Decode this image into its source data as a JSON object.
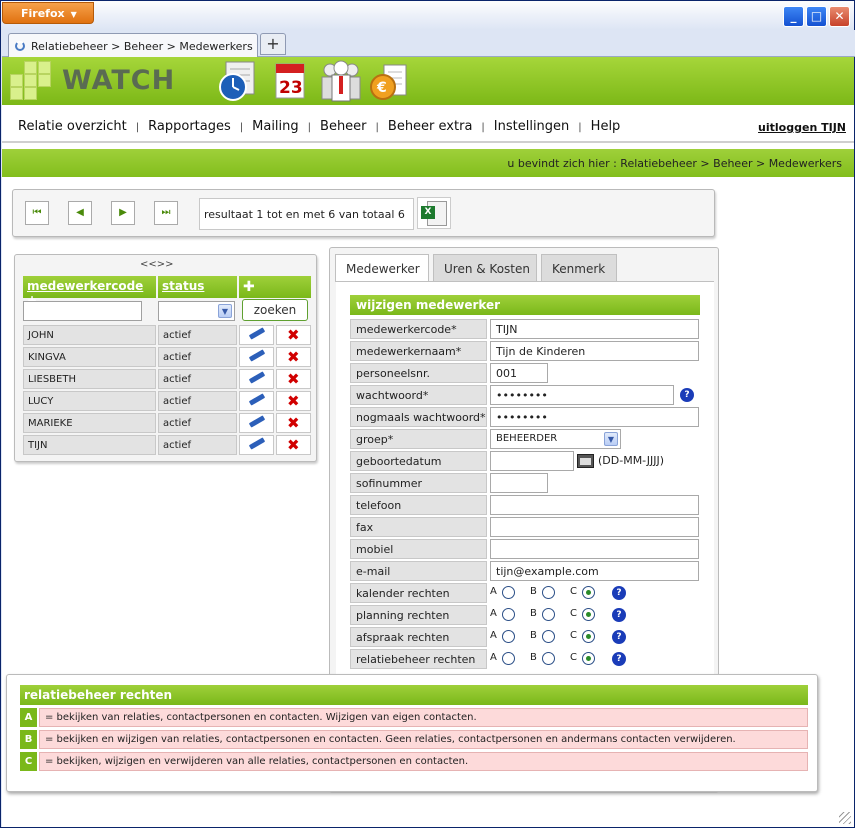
{
  "browser": {
    "menu_button": "Firefox",
    "tab_title": "Relatiebeheer > Beheer > Medewerkers",
    "new_tab": "+",
    "min": "_",
    "max": "□",
    "close": "✕"
  },
  "header": {
    "brand": "WATCH",
    "calendar_day": "23"
  },
  "nav": {
    "items": [
      "Relatie overzicht",
      "Rapportages",
      "Mailing",
      "Beheer",
      "Beheer extra",
      "Instellingen",
      "Help"
    ],
    "separator": "|",
    "logout": "uitloggen TIJN"
  },
  "breadcrumb": "u bevindt zich hier : Relatiebeheer > Beheer > Medewerkers",
  "pager": {
    "first": "⏮",
    "prev": "◀",
    "next": "▶",
    "last": "⏭",
    "result_text": "resultaat 1 tot en met 6 van totaal 6",
    "excel": "X"
  },
  "list": {
    "collapse": "<<>>",
    "col_code": "medewerkercode",
    "sort_mark": "+",
    "col_status": "status",
    "add": "✚",
    "search_button": "zoeken",
    "rows": [
      {
        "code": "JOHN",
        "status": "actief"
      },
      {
        "code": "KINGVA",
        "status": "actief"
      },
      {
        "code": "LIESBETH",
        "status": "actief"
      },
      {
        "code": "LUCY",
        "status": "actief"
      },
      {
        "code": "MARIEKE",
        "status": "actief"
      },
      {
        "code": "TIJN",
        "status": "actief"
      }
    ]
  },
  "form": {
    "tabs": [
      "Medewerker",
      "Uren & Kosten",
      "Kenmerk"
    ],
    "title": "wijzigen medewerker",
    "fields": {
      "medewerkercode": {
        "label": "medewerkercode*",
        "value": "TIJN"
      },
      "medewerkernaam": {
        "label": "medewerkernaam*",
        "value": "Tijn de Kinderen"
      },
      "personeelsnr": {
        "label": "personeelsnr.",
        "value": "001"
      },
      "wachtwoord": {
        "label": "wachtwoord*",
        "value": "••••••••"
      },
      "nogmaals": {
        "label": "nogmaals wachtwoord*",
        "value": "••••••••"
      },
      "groep": {
        "label": "groep*",
        "value": "BEHEERDER"
      },
      "geboortedatum": {
        "label": "geboortedatum",
        "value": "",
        "hint": "(DD-MM-JJJJ)"
      },
      "sofinummer": {
        "label": "sofinummer",
        "value": ""
      },
      "telefoon": {
        "label": "telefoon",
        "value": ""
      },
      "fax": {
        "label": "fax",
        "value": ""
      },
      "mobiel": {
        "label": "mobiel",
        "value": ""
      },
      "email": {
        "label": "e-mail",
        "value": "tijn@example.com"
      }
    },
    "rights": [
      {
        "label": "kalender rechten",
        "value": "C"
      },
      {
        "label": "planning rechten",
        "value": "C"
      },
      {
        "label": "afspraak rechten",
        "value": "C"
      },
      {
        "label": "relatiebeheer rechten",
        "value": "C"
      }
    ],
    "options": [
      "A",
      "B",
      "C"
    ],
    "help": "?"
  },
  "legend": {
    "title": "relatiebeheer rechten",
    "rows": [
      {
        "key": "A",
        "text": "= bekijken van relaties, contactpersonen en contacten. Wijzigen van eigen contacten."
      },
      {
        "key": "B",
        "text": "= bekijken en wijzigen van relaties, contactpersonen en contacten. Geen relaties, contactpersonen en andermans contacten verwijderen."
      },
      {
        "key": "C",
        "text": "= bekijken, wijzigen en verwijderen van alle relaties, contactpersonen en contacten."
      }
    ]
  },
  "colors": {
    "green": "#8cc424",
    "accent_blue": "#1a3cb8",
    "delete_red": "#d10000"
  }
}
